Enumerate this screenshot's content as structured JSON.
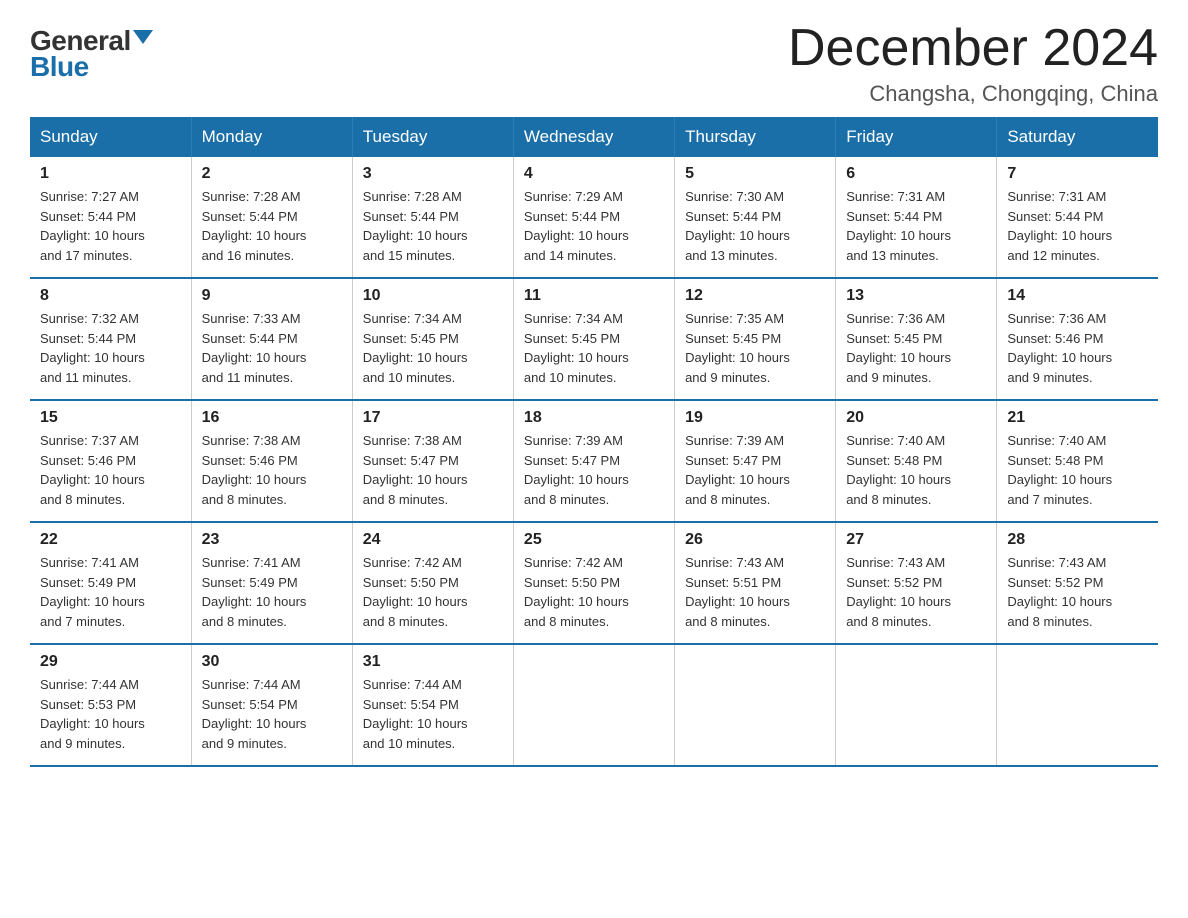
{
  "logo": {
    "general": "General",
    "blue": "Blue"
  },
  "title": {
    "month_year": "December 2024",
    "location": "Changsha, Chongqing, China"
  },
  "headers": [
    "Sunday",
    "Monday",
    "Tuesday",
    "Wednesday",
    "Thursday",
    "Friday",
    "Saturday"
  ],
  "weeks": [
    [
      {
        "day": "1",
        "sunrise": "7:27 AM",
        "sunset": "5:44 PM",
        "daylight": "10 hours and 17 minutes."
      },
      {
        "day": "2",
        "sunrise": "7:28 AM",
        "sunset": "5:44 PM",
        "daylight": "10 hours and 16 minutes."
      },
      {
        "day": "3",
        "sunrise": "7:28 AM",
        "sunset": "5:44 PM",
        "daylight": "10 hours and 15 minutes."
      },
      {
        "day": "4",
        "sunrise": "7:29 AM",
        "sunset": "5:44 PM",
        "daylight": "10 hours and 14 minutes."
      },
      {
        "day": "5",
        "sunrise": "7:30 AM",
        "sunset": "5:44 PM",
        "daylight": "10 hours and 13 minutes."
      },
      {
        "day": "6",
        "sunrise": "7:31 AM",
        "sunset": "5:44 PM",
        "daylight": "10 hours and 13 minutes."
      },
      {
        "day": "7",
        "sunrise": "7:31 AM",
        "sunset": "5:44 PM",
        "daylight": "10 hours and 12 minutes."
      }
    ],
    [
      {
        "day": "8",
        "sunrise": "7:32 AM",
        "sunset": "5:44 PM",
        "daylight": "10 hours and 11 minutes."
      },
      {
        "day": "9",
        "sunrise": "7:33 AM",
        "sunset": "5:44 PM",
        "daylight": "10 hours and 11 minutes."
      },
      {
        "day": "10",
        "sunrise": "7:34 AM",
        "sunset": "5:45 PM",
        "daylight": "10 hours and 10 minutes."
      },
      {
        "day": "11",
        "sunrise": "7:34 AM",
        "sunset": "5:45 PM",
        "daylight": "10 hours and 10 minutes."
      },
      {
        "day": "12",
        "sunrise": "7:35 AM",
        "sunset": "5:45 PM",
        "daylight": "10 hours and 9 minutes."
      },
      {
        "day": "13",
        "sunrise": "7:36 AM",
        "sunset": "5:45 PM",
        "daylight": "10 hours and 9 minutes."
      },
      {
        "day": "14",
        "sunrise": "7:36 AM",
        "sunset": "5:46 PM",
        "daylight": "10 hours and 9 minutes."
      }
    ],
    [
      {
        "day": "15",
        "sunrise": "7:37 AM",
        "sunset": "5:46 PM",
        "daylight": "10 hours and 8 minutes."
      },
      {
        "day": "16",
        "sunrise": "7:38 AM",
        "sunset": "5:46 PM",
        "daylight": "10 hours and 8 minutes."
      },
      {
        "day": "17",
        "sunrise": "7:38 AM",
        "sunset": "5:47 PM",
        "daylight": "10 hours and 8 minutes."
      },
      {
        "day": "18",
        "sunrise": "7:39 AM",
        "sunset": "5:47 PM",
        "daylight": "10 hours and 8 minutes."
      },
      {
        "day": "19",
        "sunrise": "7:39 AM",
        "sunset": "5:47 PM",
        "daylight": "10 hours and 8 minutes."
      },
      {
        "day": "20",
        "sunrise": "7:40 AM",
        "sunset": "5:48 PM",
        "daylight": "10 hours and 8 minutes."
      },
      {
        "day": "21",
        "sunrise": "7:40 AM",
        "sunset": "5:48 PM",
        "daylight": "10 hours and 7 minutes."
      }
    ],
    [
      {
        "day": "22",
        "sunrise": "7:41 AM",
        "sunset": "5:49 PM",
        "daylight": "10 hours and 7 minutes."
      },
      {
        "day": "23",
        "sunrise": "7:41 AM",
        "sunset": "5:49 PM",
        "daylight": "10 hours and 8 minutes."
      },
      {
        "day": "24",
        "sunrise": "7:42 AM",
        "sunset": "5:50 PM",
        "daylight": "10 hours and 8 minutes."
      },
      {
        "day": "25",
        "sunrise": "7:42 AM",
        "sunset": "5:50 PM",
        "daylight": "10 hours and 8 minutes."
      },
      {
        "day": "26",
        "sunrise": "7:43 AM",
        "sunset": "5:51 PM",
        "daylight": "10 hours and 8 minutes."
      },
      {
        "day": "27",
        "sunrise": "7:43 AM",
        "sunset": "5:52 PM",
        "daylight": "10 hours and 8 minutes."
      },
      {
        "day": "28",
        "sunrise": "7:43 AM",
        "sunset": "5:52 PM",
        "daylight": "10 hours and 8 minutes."
      }
    ],
    [
      {
        "day": "29",
        "sunrise": "7:44 AM",
        "sunset": "5:53 PM",
        "daylight": "10 hours and 9 minutes."
      },
      {
        "day": "30",
        "sunrise": "7:44 AM",
        "sunset": "5:54 PM",
        "daylight": "10 hours and 9 minutes."
      },
      {
        "day": "31",
        "sunrise": "7:44 AM",
        "sunset": "5:54 PM",
        "daylight": "10 hours and 10 minutes."
      },
      null,
      null,
      null,
      null
    ]
  ],
  "labels": {
    "sunrise": "Sunrise:",
    "sunset": "Sunset:",
    "daylight": "Daylight:"
  }
}
